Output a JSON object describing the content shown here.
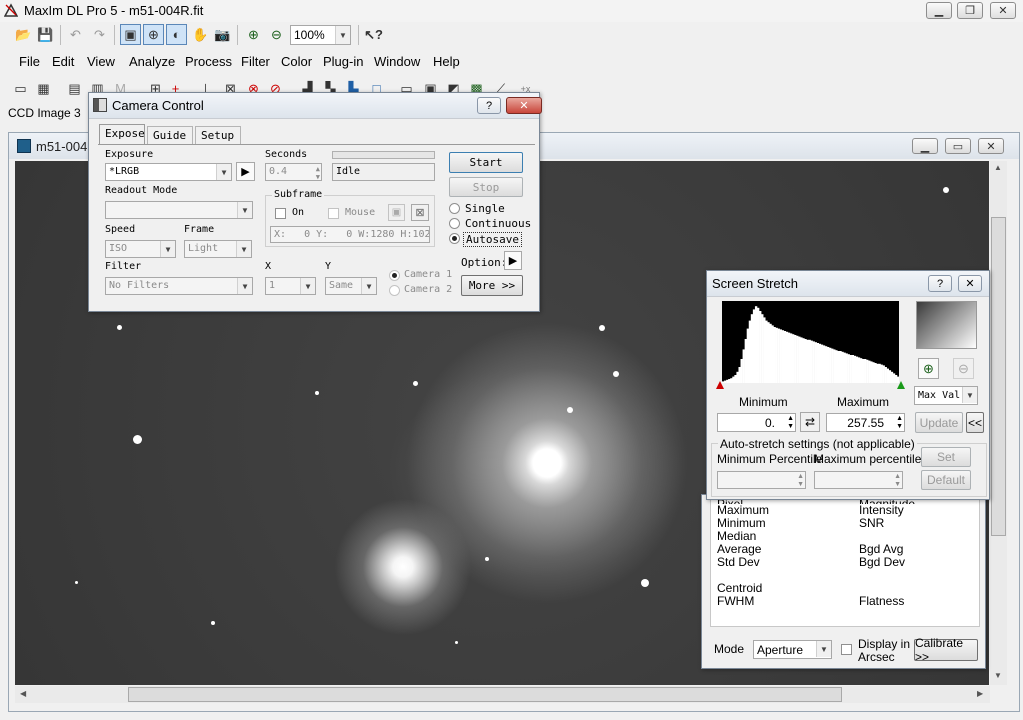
{
  "app": {
    "title": "MaxIm DL Pro 5 - m51-004R.fit",
    "logo_icon": "maxim-logo-icon"
  },
  "toolbar": {
    "zoom_value": "100%"
  },
  "menubar": [
    "File",
    "Edit",
    "View",
    "Analyze",
    "Process",
    "Filter",
    "Color",
    "Plug-in",
    "Window",
    "Help"
  ],
  "ccd_label": "CCD Image 3",
  "image_window": {
    "title": "m51-004"
  },
  "camera": {
    "title": "Camera Control",
    "tabs": [
      "Expose",
      "Guide",
      "Setup"
    ],
    "exposure_label": "Exposure",
    "exposure_value": "*LRGB",
    "seconds_label": "Seconds",
    "seconds_value": "0.4",
    "status_value": "Idle",
    "readout_label": "Readout Mode",
    "subframe_label": "Subframe",
    "on_label": "On",
    "mouse_label": "Mouse",
    "subframe_value": "X:   0 Y:   0 W:1280 H:102",
    "speed_label": "Speed",
    "speed_value": "ISO",
    "frame_label": "Frame",
    "frame_value": "Light",
    "filter_label": "Filter",
    "filter_value": "No Filters",
    "x_label": "X",
    "x_value": "1",
    "y_label": "Y",
    "y_value": "Same",
    "camera1_label": "Camera 1",
    "camera2_label": "Camera 2",
    "start_label": "Start",
    "stop_label": "Stop",
    "single_label": "Single",
    "continuous_label": "Continuous",
    "autosave_label": "Autosave",
    "options_label": "Option:",
    "more_label": "More >>"
  },
  "stretch": {
    "title": "Screen Stretch",
    "minimum_label": "Minimum",
    "maximum_label": "Maximum",
    "min_value": "0.",
    "max_value": "257.55",
    "max_val_select": "Max Val",
    "update_label": "Update",
    "collapse_label": "<<",
    "auto_group": "Auto-stretch settings (not applicable)",
    "min_pct_label": "Minimum Percentile",
    "max_pct_label": "Maximum percentile",
    "set_label": "Set",
    "default_label": "Default",
    "histogram": [
      2,
      3,
      4,
      5,
      6,
      8,
      10,
      14,
      20,
      30,
      42,
      55,
      68,
      78,
      86,
      92,
      96,
      94,
      90,
      86,
      82,
      78,
      76,
      74,
      72,
      70,
      69,
      68,
      67,
      66,
      65,
      64,
      63,
      62,
      61,
      60,
      59,
      58,
      57,
      56,
      55,
      54,
      54,
      53,
      52,
      51,
      50,
      49,
      48,
      47,
      46,
      45,
      44,
      43,
      42,
      41,
      40,
      40,
      39,
      38,
      37,
      36,
      35,
      35,
      34,
      33,
      32,
      31,
      30,
      30,
      29,
      28,
      27,
      26,
      25,
      24,
      24,
      23,
      22,
      20,
      18,
      16,
      14,
      12,
      10,
      8
    ]
  },
  "info": {
    "col1": [
      "Pixel",
      "Maximum",
      "Minimum",
      "Median",
      "Average",
      "Std Dev",
      "",
      "Centroid",
      "FWHM"
    ],
    "col2": [
      "Magnitude",
      "Intensity",
      "SNR",
      "",
      "Bgd Avg",
      "Bgd Dev",
      "",
      "",
      "Flatness"
    ],
    "mode_label": "Mode",
    "mode_value": "Aperture",
    "display_label_1": "Display in",
    "display_label_2": "Arcsec",
    "calibrate_label": "Calibrate >>"
  }
}
